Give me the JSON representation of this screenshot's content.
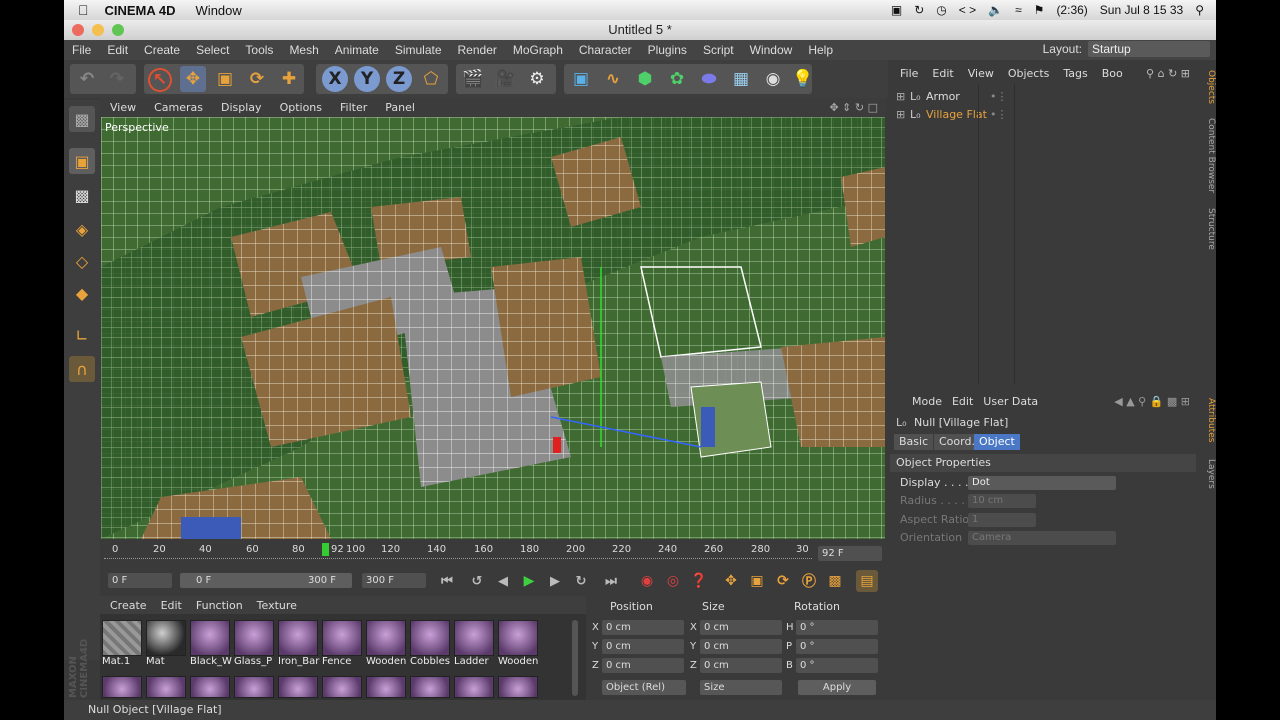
{
  "macbar": {
    "app_name": "CINEMA 4D",
    "menu_window": "Window",
    "battery": "(2:36)",
    "datetime": "Sun Jul 8  15 33"
  },
  "window": {
    "title": "Untitled 5 *"
  },
  "menu": {
    "items": [
      "File",
      "Edit",
      "Create",
      "Select",
      "Tools",
      "Mesh",
      "Animate",
      "Simulate",
      "Render",
      "MoGraph",
      "Character",
      "Plugins",
      "Script",
      "Window",
      "Help"
    ],
    "layout_label": "Layout:",
    "layout_value": "Startup"
  },
  "toolbar": {
    "axis_x": "X",
    "axis_y": "Y",
    "axis_z": "Z"
  },
  "viewport": {
    "menu": [
      "View",
      "Cameras",
      "Display",
      "Options",
      "Filter",
      "Panel"
    ],
    "camera_label": "Perspective"
  },
  "timeline": {
    "ticks": [
      "0",
      "20",
      "40",
      "60",
      "80",
      "92",
      "100",
      "120",
      "140",
      "160",
      "180",
      "200",
      "220",
      "240",
      "260",
      "280",
      "30"
    ],
    "current_frame_display": "92 F",
    "current_frame": 92,
    "max_frame": 300
  },
  "transport": {
    "start_field": "0 F",
    "range_start": "0 F",
    "range_end": "300 F",
    "end_field": "300 F"
  },
  "materials": {
    "menu": [
      "Create",
      "Edit",
      "Function",
      "Texture"
    ],
    "labels": [
      "Mat.1",
      "Mat",
      "Black_W",
      "Glass_P",
      "Iron_Bar",
      "Fence",
      "Wooden",
      "Cobbles",
      "Ladder",
      "Wooden"
    ]
  },
  "coordinates": {
    "headers": [
      "Position",
      "Size",
      "Rotation"
    ],
    "rows": [
      {
        "axis": "X",
        "pos": "0 cm",
        "size_axis": "X",
        "size": "0 cm",
        "rot_axis": "H",
        "rot": "0 °"
      },
      {
        "axis": "Y",
        "pos": "0 cm",
        "size_axis": "Y",
        "size": "0 cm",
        "rot_axis": "P",
        "rot": "0 °"
      },
      {
        "axis": "Z",
        "pos": "0 cm",
        "size_axis": "Z",
        "size": "0 cm",
        "rot_axis": "B",
        "rot": "0 °"
      }
    ],
    "mode_select": "Object (Rel)",
    "size_select": "Size",
    "apply_label": "Apply"
  },
  "objects": {
    "menu": [
      "File",
      "Edit",
      "View",
      "Objects",
      "Tags",
      "Boo"
    ],
    "items": [
      {
        "name": "Armor",
        "selected": false
      },
      {
        "name": "Village Flat",
        "selected": true
      }
    ]
  },
  "attributes": {
    "menu": [
      "Mode",
      "Edit",
      "User Data"
    ],
    "object_title": "Null [Village Flat]",
    "tabs": [
      "Basic",
      "Coord.",
      "Object"
    ],
    "active_tab": "Object",
    "section_title": "Object Properties",
    "props": [
      {
        "label": "Display . . . .",
        "value": "Dot",
        "enabled": true
      },
      {
        "label": "Radius . . . .",
        "value": "10 cm",
        "enabled": false
      },
      {
        "label": "Aspect Ratio",
        "value": "1",
        "enabled": false
      },
      {
        "label": "Orientation",
        "value": "Camera",
        "enabled": false
      }
    ]
  },
  "side_tabs": [
    "Objects",
    "Content Browser",
    "Structure",
    "Attributes",
    "Layers"
  ],
  "status": {
    "text": "Null Object [Village Flat]"
  },
  "colors": {
    "ui_bg": "#3a3a3a",
    "accent_orange": "#e8a23c",
    "selection_blue": "#4a78c6",
    "viewport_grass": "#4d7a3b"
  }
}
